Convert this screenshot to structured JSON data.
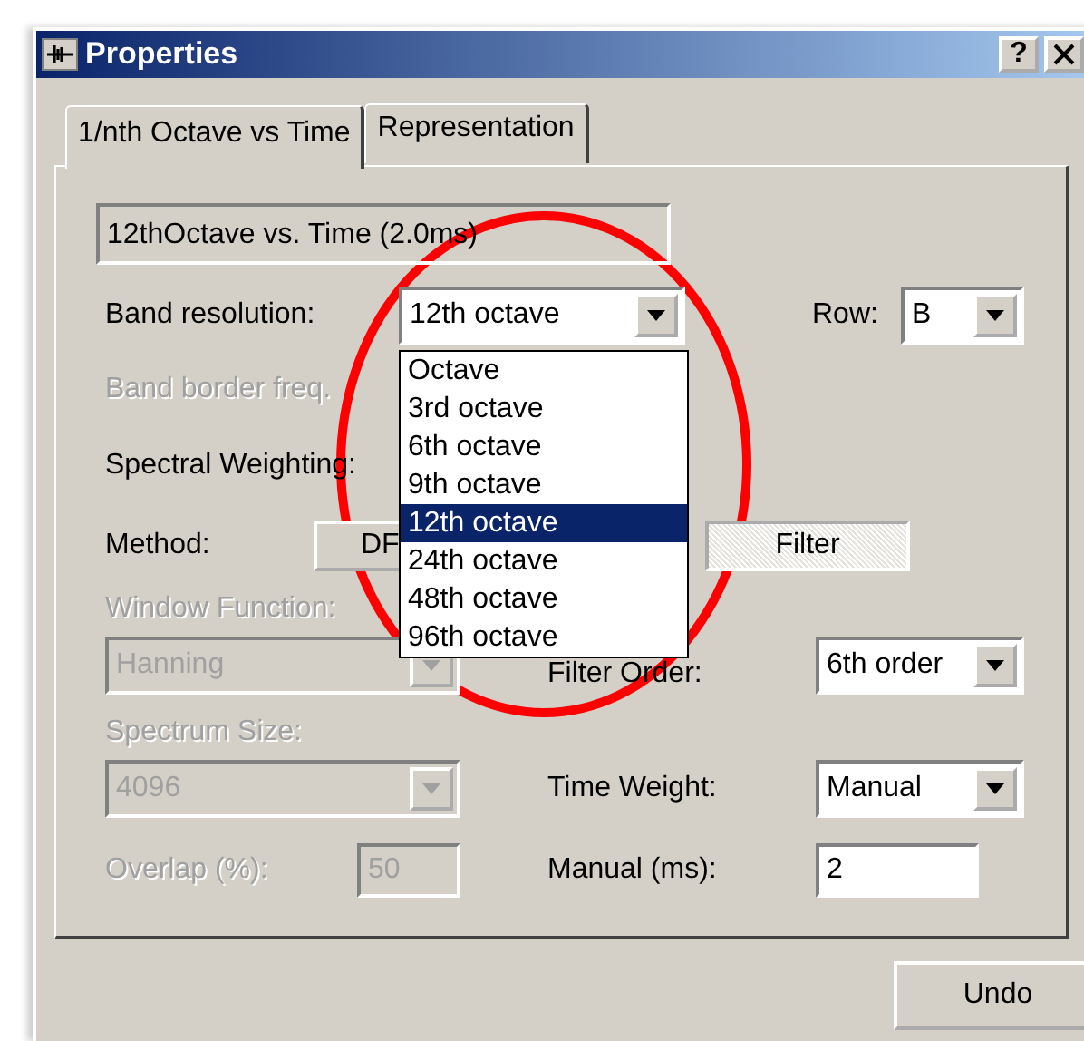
{
  "window": {
    "title": "Properties",
    "help": "?"
  },
  "tabs": [
    {
      "label": "1/nth Octave  vs Time",
      "selected": true
    },
    {
      "label": "Representation",
      "selected": false
    }
  ],
  "summary": "12thOctave vs. Time (2.0ms)",
  "band_resolution": {
    "label": "Band resolution:",
    "value": "12th octave",
    "disabled": false
  },
  "row": {
    "label": "Row:",
    "value": "B",
    "disabled": false
  },
  "band_border_freq": {
    "label": "Band border freq.",
    "disabled": true
  },
  "spectral_weighting": {
    "label": "Spectral Weighting:",
    "disabled": false
  },
  "method": {
    "label": "Method:",
    "options": [
      {
        "label": "DF",
        "selected": false
      },
      {
        "label": "Filter",
        "selected": true
      }
    ]
  },
  "window_function": {
    "label": "Window Function:",
    "value": "Hanning",
    "disabled": true
  },
  "filter_order": {
    "label": "Filter Order:",
    "value": "6th order",
    "disabled": false
  },
  "spectrum_size": {
    "label": "Spectrum Size:",
    "value": "4096",
    "disabled": true
  },
  "time_weight": {
    "label": "Time Weight:",
    "value": "Manual",
    "disabled": false
  },
  "overlap": {
    "label": "Overlap (%):",
    "value": "50",
    "disabled": true
  },
  "manual_ms": {
    "label": "Manual (ms):",
    "value": "2",
    "disabled": false
  },
  "dropdown_list": [
    {
      "label": "Octave",
      "selected": false
    },
    {
      "label": "3rd octave",
      "selected": false
    },
    {
      "label": "6th octave",
      "selected": false
    },
    {
      "label": "9th octave",
      "selected": false
    },
    {
      "label": "12th octave",
      "selected": true
    },
    {
      "label": "24th octave",
      "selected": false
    },
    {
      "label": "48th octave",
      "selected": false
    },
    {
      "label": "96th octave",
      "selected": false
    }
  ],
  "buttons": [
    "Undo"
  ]
}
